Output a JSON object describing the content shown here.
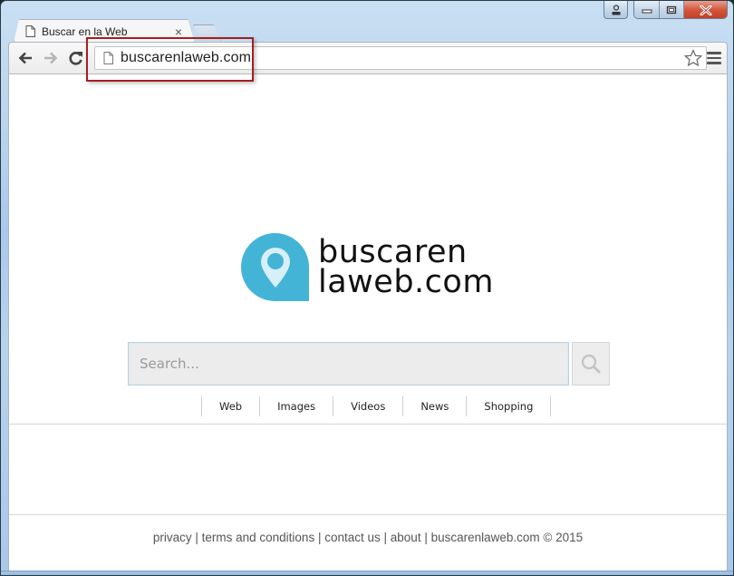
{
  "window": {
    "controls": {
      "profile": "profile-icon",
      "minimize": "minimize-icon",
      "maximize": "maximize-icon",
      "close": "close-icon"
    }
  },
  "tab": {
    "title": "Buscar en la Web",
    "icon": "page-icon",
    "close": "×"
  },
  "toolbar": {
    "back": "back-arrow-icon",
    "forward": "forward-arrow-icon",
    "reload": "reload-icon",
    "url": "buscarenlaweb.com",
    "bookmark": "star-icon",
    "menu": "hamburger-menu-icon"
  },
  "page": {
    "logo": {
      "line1": "buscaren",
      "line2": "laweb.com",
      "icon": "map-pin-icon",
      "color": "#44b4d6"
    },
    "search": {
      "placeholder": "Search...",
      "value": "",
      "button_icon": "search-icon"
    },
    "verticals": [
      "Web",
      "Images",
      "Videos",
      "News",
      "Shopping"
    ],
    "footer": {
      "links": [
        "privacy",
        "terms and conditions",
        "contact us",
        "about"
      ],
      "copyright": "buscarenlaweb.com © 2015",
      "separator": " | "
    }
  },
  "annotation": {
    "color": "#a41e22"
  }
}
